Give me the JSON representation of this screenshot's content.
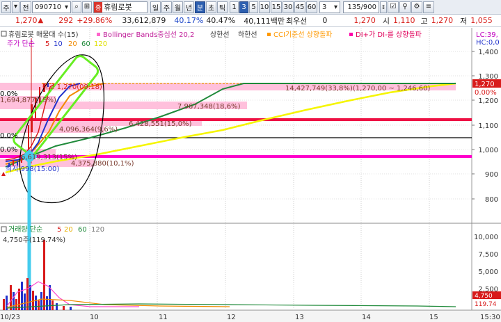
{
  "toolbar": {
    "market": "주",
    "prev": "전",
    "code": "090710",
    "name_tag": "증",
    "name": "휴림로봇",
    "periods": [
      "일",
      "주",
      "월",
      "년",
      "분",
      "초",
      "틱"
    ],
    "active_period": "분",
    "intervals": [
      "1",
      "3",
      "5",
      "10",
      "15",
      "30",
      "45",
      "60"
    ],
    "active_interval": "3",
    "minute_select": "3",
    "count": "135/900"
  },
  "quote": {
    "price": "1,270",
    "change": "292",
    "change_pct": "+29.86%",
    "volume": "33,612,879",
    "ratio1": "40.17%",
    "ratio2": "40.47%",
    "amount": "40,111백만",
    "min_label": "최우선",
    "min_value": "0",
    "current": "1,270",
    "high_label": "시",
    "open": "1,110",
    "high_label2": "고",
    "high": "1,270",
    "low_label": "저",
    "low": "1,055"
  },
  "legend": {
    "title": "휴림로봇 매물대 수(15)",
    "bollinger": "Bollinger Bands중심선 20,2",
    "upper": "상한선",
    "lower": "하한선",
    "cci": "CCI기준선 상향돌파",
    "di": "DI+가 DI-를 상향돌파",
    "ma_label": "주가 단순",
    "ma_periods": [
      "5",
      "10",
      "20",
      "60",
      "120"
    ],
    "lc": "LC:39,",
    "hc": "HC:0,0"
  },
  "price_axis": [
    "1,400",
    "1,300",
    "1,200",
    "1,100",
    "1,000",
    "900",
    "800"
  ],
  "price_tags": {
    "current": "1,270",
    "pct": "0.00%"
  },
  "volume_profile": [
    {
      "label": "14,427,749(33,8%)(1,270,00 ~ 1,246,60)"
    },
    {
      "label": "7,967,348(18,6%)"
    },
    {
      "label": "6,428,551(15,0%)"
    },
    {
      "label": "4,096,364(9,6%)"
    },
    {
      "label": "4,375,880(10,1%)"
    },
    {
      "label": "1,694,877(15%)"
    }
  ],
  "chart_annotations": {
    "top_mark": "최고 1,270(09:18)",
    "zero_a": "0.0%",
    "zero_b": "0.0%",
    "zero_c": "0.0%",
    "low_mark": "최저 998(15:00)",
    "stock_note": "6,619,313(15%)"
  },
  "volume_panel": {
    "legend_label": "거래량 단순",
    "ma_periods": [
      "5",
      "20",
      "60",
      "120"
    ],
    "value_label": "4,750주(119.74%)",
    "axis": [
      "10,000",
      "7,500",
      "5,000",
      "2,500"
    ],
    "tags": [
      "4,750",
      "119.74"
    ]
  },
  "time_axis": [
    "10/23",
    "10",
    "11",
    "12",
    "13",
    "14",
    "15",
    "15:30"
  ],
  "colors": {
    "ma5": "#d81b1b",
    "ma10": "#2233cc",
    "ma20": "#f08a00",
    "ma60": "#1f8a3a",
    "ma120": "#f5f500",
    "highlight": "#ff1493",
    "red_line": "#ee1144",
    "magenta_line": "#ff00cc",
    "cyan": "#44ccee",
    "green_box": "#66ee22"
  }
}
